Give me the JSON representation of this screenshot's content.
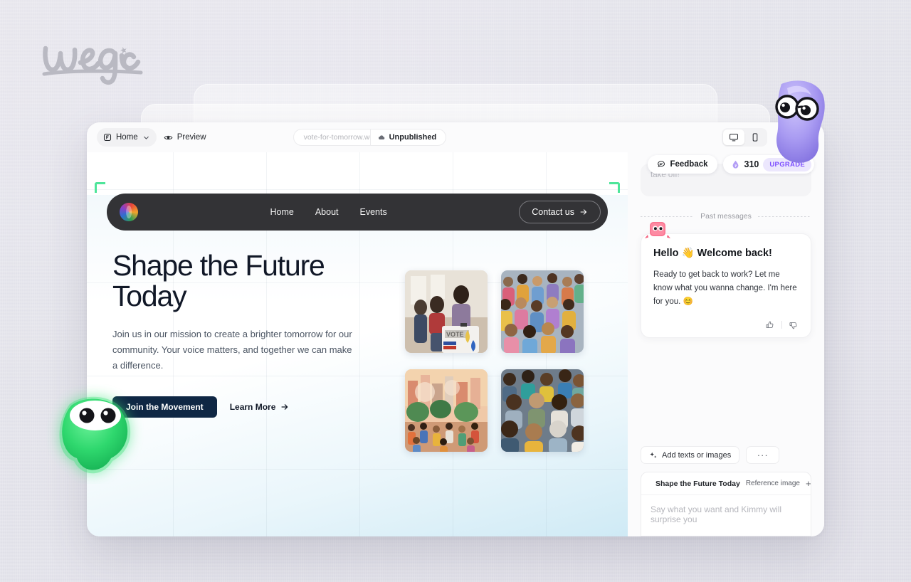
{
  "brand": {
    "logo_text": "wegic"
  },
  "toolbar": {
    "page_selector": {
      "label": "Home",
      "icon": "frame-icon",
      "chevron": "chevron-down-icon"
    },
    "preview": {
      "label": "Preview",
      "icon": "eye-icon"
    },
    "url": {
      "value": "vote-for-tomorrow.we",
      "truncated": true
    },
    "status": {
      "label": "Unpublished",
      "icon": "cloud-off-icon"
    },
    "devices": [
      {
        "name": "desktop",
        "icon": "monitor-icon",
        "active": true
      },
      {
        "name": "mobile",
        "icon": "phone-icon",
        "active": false
      }
    ],
    "actions": [
      {
        "name": "typography",
        "icon": "font-icon"
      },
      {
        "name": "settings",
        "icon": "gear-icon"
      }
    ]
  },
  "site": {
    "nav": {
      "logo": "site-logo-icon",
      "links": [
        "Home",
        "About",
        "Events"
      ],
      "cta": {
        "label": "Contact us",
        "icon": "arrow-right-icon"
      }
    },
    "hero": {
      "title_line1": "Shape the Future",
      "title_line2": "Today",
      "subtitle": "Join us in our mission to create a brighter tomorrow for our community. Your voice matters, and together we can make a difference.",
      "primary_cta": "Join the Movement",
      "secondary_cta": "Learn More",
      "secondary_cta_icon": "arrow-right-icon"
    },
    "gallery": [
      {
        "alt": "voter casting ballot at ballot box in community hall"
      },
      {
        "alt": "illustrated diverse crowd of people standing together"
      },
      {
        "alt": "illustrated city park rally with crowd and trees"
      },
      {
        "alt": "photo of a large smiling diverse crowd"
      }
    ]
  },
  "sidebar": {
    "feedback": {
      "label": "Feedback",
      "icon": "chat-bubble-icon"
    },
    "credits": {
      "count": "310",
      "icon": "credit-drop-icon"
    },
    "upgrade": {
      "label": "UPGRADE"
    },
    "clipped_message": "take off!",
    "divider_label": "Past messages",
    "message": {
      "avatar": "bot-avatar-icon",
      "title": "Hello 👋 Welcome back!",
      "body": "Ready to get back to work? Let me know what you wanna change. I'm here for you. 😊",
      "reactions": [
        {
          "name": "thumbs-up",
          "icon": "thumbs-up-icon"
        },
        {
          "name": "thumbs-down",
          "icon": "thumbs-down-icon"
        }
      ]
    },
    "composer": {
      "add_button": {
        "label": "Add texts or images",
        "icon": "sparkle-icon"
      },
      "more_button": {
        "label": "···"
      },
      "context_chip": {
        "label": "Shape the Future Today",
        "icon": "collapse-left-icon"
      },
      "reference_image": {
        "label": "Reference image",
        "plus": "+"
      },
      "input_placeholder": "Say what you want and Kimmy will surprise you"
    }
  },
  "mascots": [
    {
      "name": "purple-ghost-mascot",
      "color": "#a79bf0"
    },
    {
      "name": "green-blob-mascot",
      "color": "#31d46a"
    }
  ],
  "colors": {
    "page_bg": "#e2e2e8",
    "nav_dark": "#333336",
    "cta_navy": "#0f2744",
    "accent_purple": "#7c4dff",
    "selection_green": "#4ee59a"
  }
}
